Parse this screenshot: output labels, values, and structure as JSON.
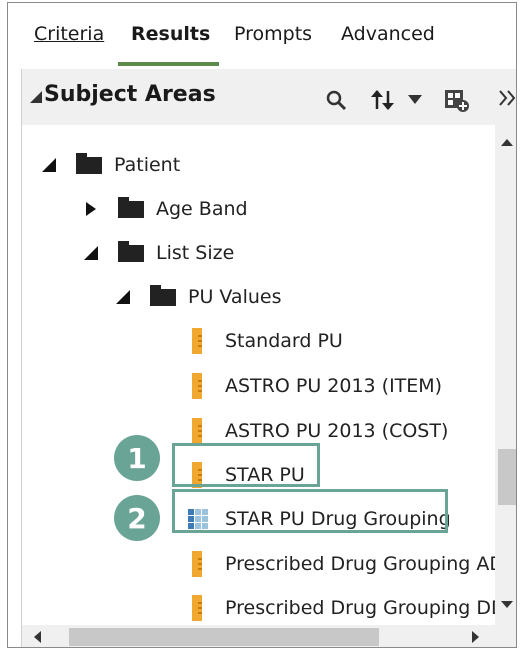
{
  "tabs": [
    {
      "label": "Criteria"
    },
    {
      "label": "Results"
    },
    {
      "label": "Prompts"
    },
    {
      "label": "Advanced"
    }
  ],
  "panel": {
    "title": "Subject Areas",
    "icons": [
      "search-icon",
      "sort-icon",
      "add-columns-icon",
      "expand-panel-icon"
    ]
  },
  "tree": {
    "items": [
      {
        "label": "Patient"
      },
      {
        "label": "Age Band"
      },
      {
        "label": "List Size"
      },
      {
        "label": "PU Values"
      },
      {
        "label": "Standard PU"
      },
      {
        "label": "ASTRO PU 2013 (ITEM)"
      },
      {
        "label": "ASTRO PU 2013 (COST)"
      },
      {
        "label": "STAR PU"
      },
      {
        "label": "STAR PU Drug Grouping"
      },
      {
        "label": "Prescribed Drug Grouping AD"
      },
      {
        "label": "Prescribed Drug Grouping DD"
      }
    ]
  },
  "callouts": [
    {
      "number": "1"
    },
    {
      "number": "2"
    }
  ],
  "colors": {
    "accent": "#6aa497",
    "tab_underline": "#5f8a4e",
    "measure_icon": "#f0a830"
  }
}
